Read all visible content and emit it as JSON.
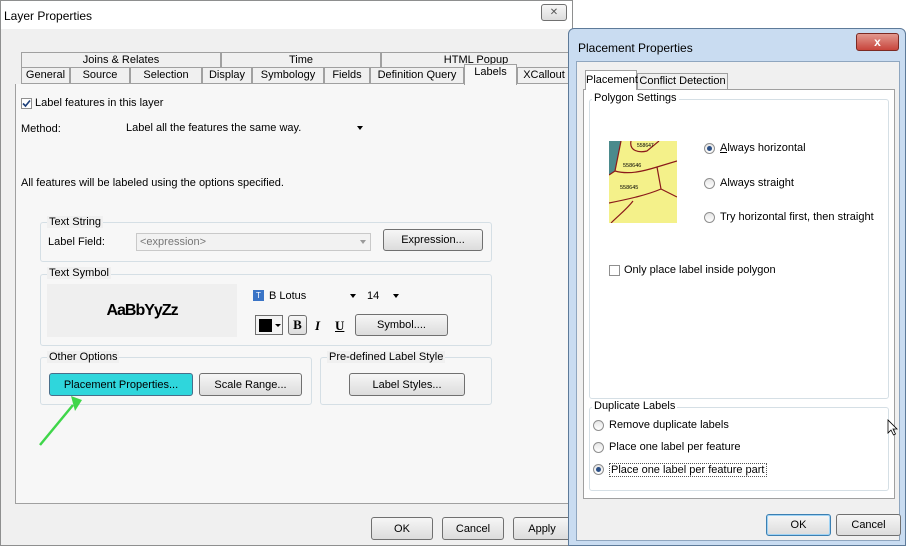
{
  "layer_dialog": {
    "title": "Layer Properties",
    "tabs_top": [
      "Joins & Relates",
      "Time",
      "HTML Popup"
    ],
    "tabs_bottom": [
      "General",
      "Source",
      "Selection",
      "Display",
      "Symbology",
      "Fields",
      "Definition Query",
      "Labels",
      "XCallout"
    ],
    "active_tab": "Labels",
    "label_features_checkbox": "Label features in this layer",
    "label_features_checked": true,
    "method_label": "Method:",
    "method_value": "Label all the features the same way.",
    "info_text": "All features will be labeled using the options specified.",
    "text_string_group": "Text String",
    "label_field_label": "Label Field:",
    "label_field_value": "<expression>",
    "expression_button": "Expression...",
    "text_symbol_group": "Text Symbol",
    "preview_text": "AaBbYyZz",
    "font_name": "B Lotus",
    "font_size": "14",
    "bold": "B",
    "italic": "I",
    "underline": "U",
    "symbol_button": "Symbol....",
    "other_options_group": "Other Options",
    "placement_button": "Placement Properties...",
    "scale_range_button": "Scale Range...",
    "predefined_group": "Pre-defined Label Style",
    "label_styles_button": "Label Styles...",
    "ok": "OK",
    "cancel": "Cancel",
    "apply": "Apply",
    "close_glyph": "✕"
  },
  "placement_dialog": {
    "title": "Placement Properties",
    "close_glyph": "x",
    "tabs": [
      "Placement",
      "Conflict Detection"
    ],
    "polygon_settings": "Polygon Settings",
    "map_labels": [
      "558647",
      "558646",
      "558645"
    ],
    "radio_horizontal": "Always horizontal",
    "radio_straight": "Always straight",
    "radio_try": "Try horizontal first, then straight",
    "polygon_radio_selected": "Always horizontal",
    "only_inside": "Only place label inside polygon",
    "duplicate_group": "Duplicate Labels",
    "dup_remove": "Remove duplicate labels",
    "dup_per_feature": "Place one label per feature",
    "dup_per_part": "Place one label per feature part",
    "dup_selected": "Place one label per feature part",
    "ok": "OK",
    "cancel": "Cancel"
  },
  "colors": {
    "placement_button_bg": "#2fd6dc",
    "arrow": "#3fd64a",
    "map_fill": "#f4f18a",
    "map_outline": "#8b1a1a",
    "map_water": "#4b8a8c",
    "title_red": "#c8453c"
  }
}
